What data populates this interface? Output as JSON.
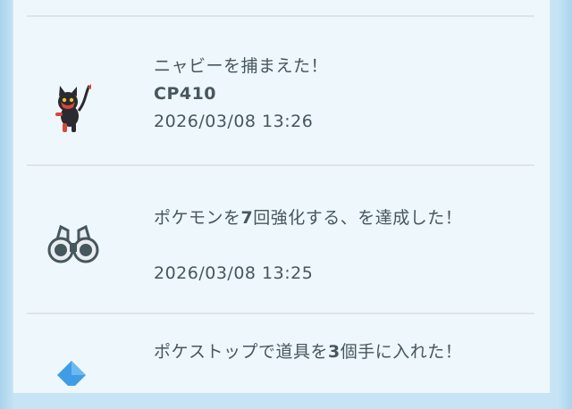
{
  "feed": {
    "items": [
      {
        "icon": "litten-pokemon-icon",
        "title": "ニャビーを捕まえた！",
        "subtitle": "CP410",
        "timestamp": "2026/03/08 13:26"
      },
      {
        "icon": "binoculars-icon",
        "title_prefix": "ポケモンを",
        "title_number": "7",
        "title_suffix": "回強化する、を達成した！",
        "timestamp": "2026/03/08 13:25"
      },
      {
        "icon": "pokestop-icon",
        "title_prefix": "ポケストップで道具を",
        "title_number": "3",
        "title_suffix": "個手に入れた！"
      }
    ]
  },
  "colors": {
    "background": "#c6e4f4",
    "panel": "#eef7fb",
    "text": "#46575d",
    "divider": "#dde5ea",
    "pokestop_blue": "#3f9de6"
  }
}
